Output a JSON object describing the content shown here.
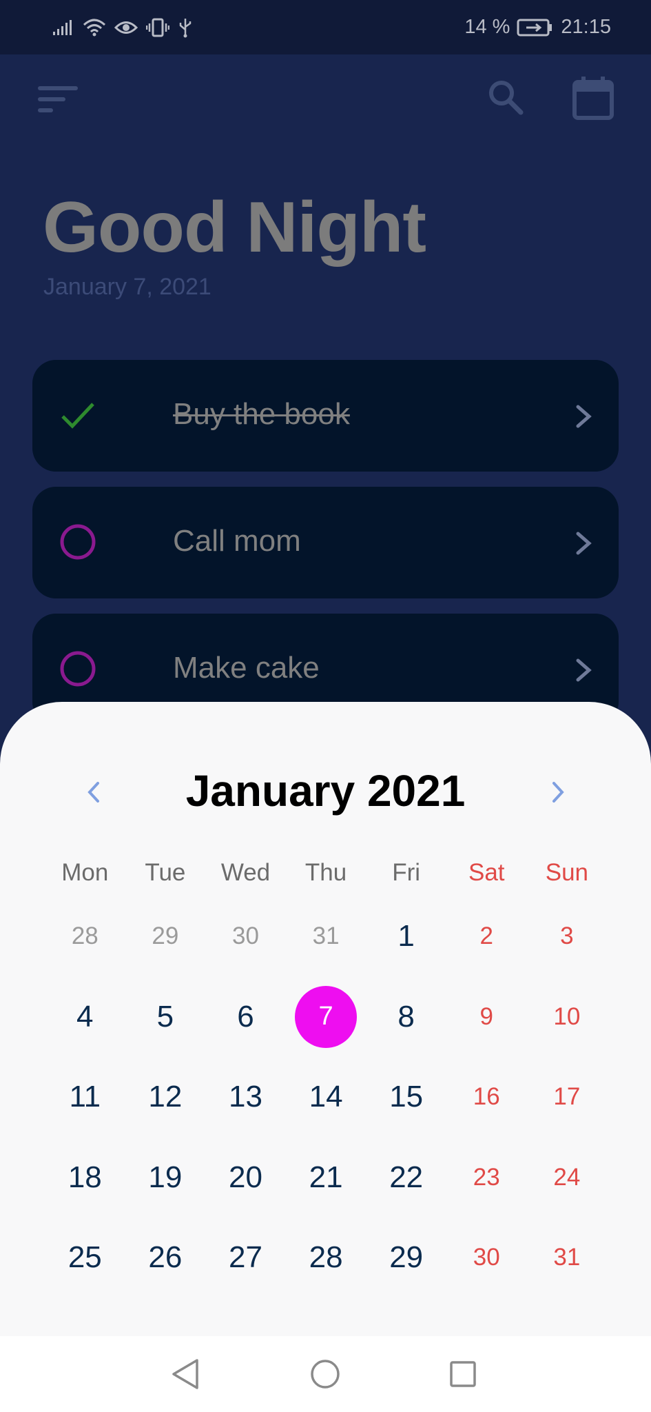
{
  "status_bar": {
    "battery_percent": "14 %",
    "time": "21:15",
    "icons": [
      "signal-icon",
      "wifi-icon",
      "eye-icon",
      "vibrate-icon",
      "usb-icon",
      "battery-charging-icon"
    ]
  },
  "toolbar": {
    "icons": [
      "menu-icon",
      "search-icon",
      "calendar-icon"
    ]
  },
  "header": {
    "greeting": "Good Night",
    "date": "January 7, 2021"
  },
  "tasks": [
    {
      "label": "Buy the book",
      "done": true
    },
    {
      "label": "Call mom",
      "done": false
    },
    {
      "label": "Make cake",
      "done": false
    }
  ],
  "calendar": {
    "month_title": "January 2021",
    "weekdays": [
      "Mon",
      "Tue",
      "Wed",
      "Thu",
      "Fri",
      "Sat",
      "Sun"
    ],
    "days": [
      "28",
      "29",
      "30",
      "31",
      "1",
      "2",
      "3",
      "4",
      "5",
      "6",
      "7",
      "8",
      "9",
      "10",
      "11",
      "12",
      "13",
      "14",
      "15",
      "16",
      "17",
      "18",
      "19",
      "20",
      "21",
      "22",
      "23",
      "24",
      "25",
      "26",
      "27",
      "28",
      "29",
      "30",
      "31"
    ],
    "selected_day": "7",
    "leading_muted_count": 4
  },
  "colors": {
    "accent_selected": "#ee0ef0",
    "weekend": "#e04a47",
    "check_done": "#2e8b2e",
    "circle_pending": "#8a1a8f",
    "background": "#18254e",
    "card": "#03142a"
  }
}
